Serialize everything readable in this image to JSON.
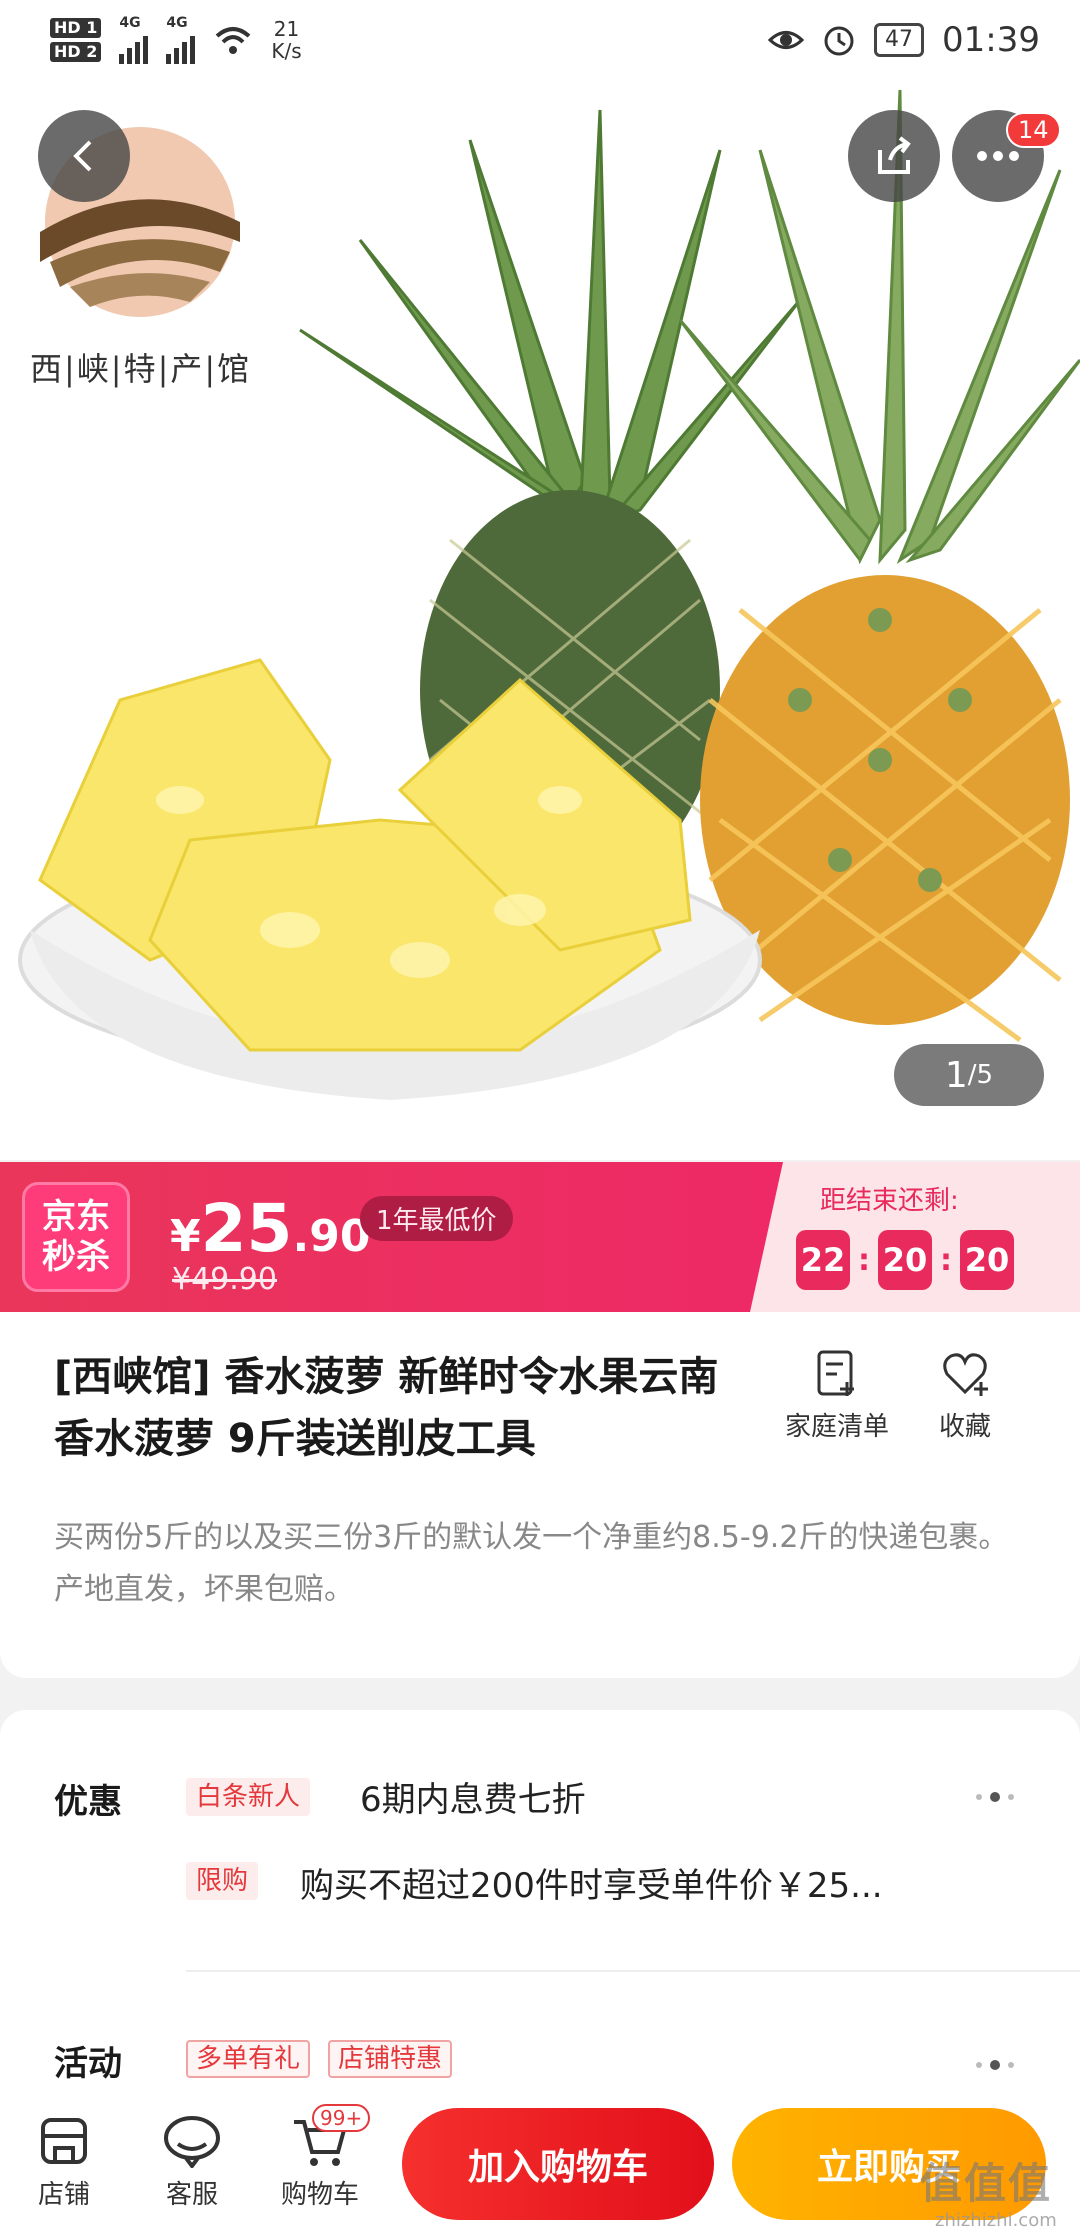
{
  "status_bar": {
    "hd1": "HD 1",
    "hd2": "HD 2",
    "net1": "4G",
    "net2": "4G",
    "speed_value": "21",
    "speed_unit": "K/s",
    "battery": "47",
    "time": "01:39"
  },
  "nav": {
    "more_badge": "14"
  },
  "shop_logo": {
    "name": "西|峡|特|产|馆"
  },
  "gallery": {
    "current": "1",
    "total": "/5"
  },
  "seckill": {
    "logo_line1": "京东",
    "logo_line2": "秒杀",
    "currency": "¥",
    "price_int": "25",
    "price_dec": ".90",
    "tag": "1年最低价",
    "original_price": "¥49.90",
    "end_label": "距结束还剩:",
    "hours": "22",
    "minutes": "20",
    "seconds": "20"
  },
  "product": {
    "title": "[西峡馆] 香水菠萝 新鲜时令水果云南香水菠萝 9斤装送削皮工具",
    "list_label": "家庭清单",
    "fav_label": "收藏",
    "desc": "买两份5斤的以及买三份3斤的默认发一个净重约8.5-9.2斤的快递包裹。产地直发，坏果包赔。"
  },
  "promo": {
    "label": "优惠",
    "tag1": "白条新人",
    "text1": "6期内息费七折",
    "tag2": "限购",
    "text2": "购买不超过200件时享受单件价￥25...",
    "activity_label": "活动",
    "activity_tag1": "多单有礼",
    "activity_tag2": "店铺特惠"
  },
  "bottom_bar": {
    "shop": "店铺",
    "service": "客服",
    "cart": "购物车",
    "cart_badge": "99+",
    "add_cart": "加入购物车",
    "buy_now": "立即购买"
  },
  "watermark": {
    "text": "值值值",
    "url": "zhizhizhi.com"
  },
  "colors": {
    "seckill_pink": "#f0246b",
    "jd_red": "#e4393c",
    "buy_orange": "#ff9a00"
  }
}
